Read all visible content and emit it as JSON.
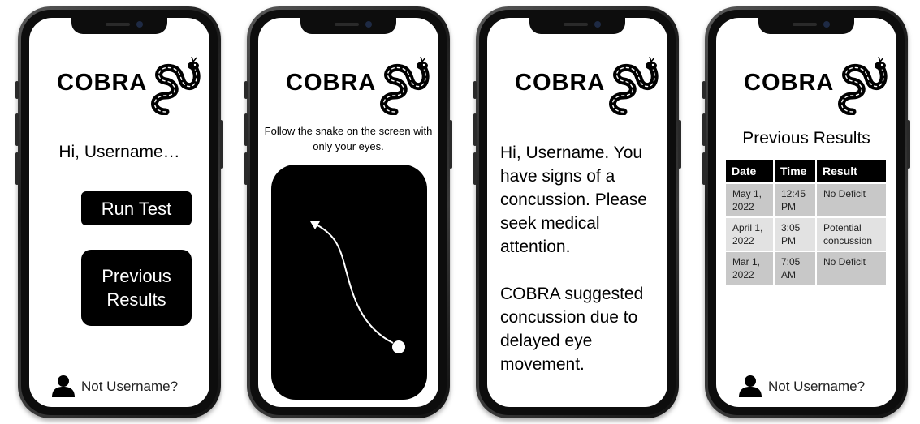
{
  "app": {
    "logo_text": "COBRA"
  },
  "home": {
    "greeting": "Hi, Username…",
    "run_test_label": "Run Test",
    "previous_results_label": "Previous Results",
    "footer_label": "Not Username?"
  },
  "test": {
    "instruction": "Follow the snake on the screen with only your eyes."
  },
  "result": {
    "message_1": "Hi, Username. You have signs of a concussion. Please seek medical attention.",
    "message_2": "COBRA suggested concussion due to delayed eye movement."
  },
  "history": {
    "title": "Previous Results",
    "columns": [
      "Date",
      "Time",
      "Result"
    ],
    "rows": [
      [
        "May 1, 2022",
        "12:45 PM",
        "No Deficit"
      ],
      [
        "April 1, 2022",
        "3:05 PM",
        "Potential concussion"
      ],
      [
        "Mar 1, 2022",
        "7:05 AM",
        "No Deficit"
      ]
    ],
    "footer_label": "Not Username?"
  },
  "icons": [
    "cobra-snake-logo",
    "user-icon",
    "moving-dot",
    "path-arrow"
  ],
  "colors": {
    "button": "#000000",
    "table_cell": "#c8c8c8",
    "table_cell_alt": "#e2e2e2"
  }
}
